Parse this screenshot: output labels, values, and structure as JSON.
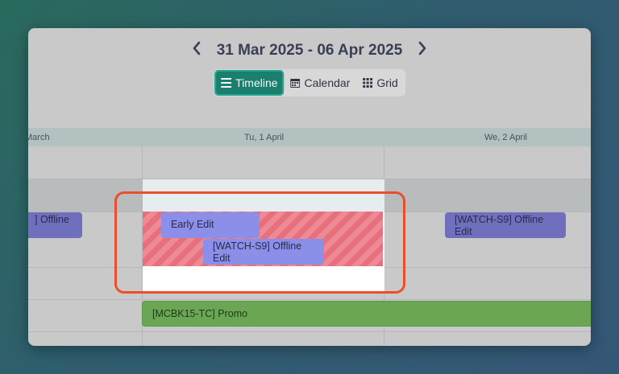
{
  "header": {
    "prev_label": "‹",
    "next_label": "›",
    "date_range": "31 Mar 2025 - 06 Apr 2025"
  },
  "view_switch": {
    "options": [
      {
        "label": "Timeline",
        "icon": "list-icon",
        "active": true
      },
      {
        "label": "Calendar",
        "icon": "calendar-icon",
        "active": false
      },
      {
        "label": "Grid",
        "icon": "grid-icon",
        "active": false
      }
    ]
  },
  "days": [
    "March",
    "Tu, 1 April",
    "We, 2 April"
  ],
  "events": {
    "offline_left": "] Offline",
    "early_edit": "Early Edit",
    "watch_center": "[WATCH-S9] Offline Edit",
    "watch_right": "[WATCH-S9] Offline Edit",
    "promo": "[MCBK15-TC] Promo"
  },
  "colors": {
    "accent": "#1a7f6e",
    "selection": "#e94e2e",
    "event_purple": "#8b8fe8",
    "event_green": "#6aa653",
    "hatched": "#e7707d"
  }
}
